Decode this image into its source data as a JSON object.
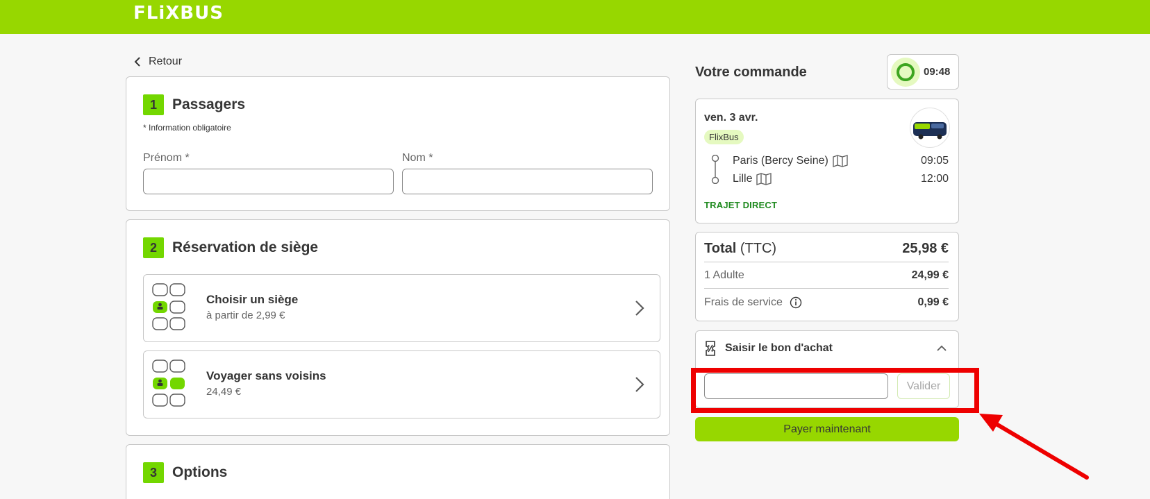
{
  "header": {
    "logo": "FLiXBUS"
  },
  "nav": {
    "back_label": "Retour"
  },
  "passengers": {
    "step": "1",
    "title": "Passagers",
    "required_note": "* Information obligatoire",
    "first_name_label": "Prénom *",
    "last_name_label": "Nom *"
  },
  "seats": {
    "step": "2",
    "title": "Réservation de siège",
    "options": [
      {
        "title": "Choisir un siège",
        "subtitle": "à partir de 2,99 €"
      },
      {
        "title": "Voyager sans voisins",
        "subtitle": "24,49 €"
      }
    ]
  },
  "options": {
    "step": "3",
    "title": "Options"
  },
  "order": {
    "title": "Votre commande",
    "timer": "09:48",
    "trip": {
      "date": "ven. 3 avr.",
      "brand": "FlixBus",
      "stops": [
        {
          "city": "Paris (Bercy Seine)",
          "time": "09:05"
        },
        {
          "city": "Lille",
          "time": "12:00"
        }
      ],
      "direct_label": "TRAJET DIRECT"
    },
    "totals": {
      "total_label": "Total",
      "total_suffix": "(TTC)",
      "total_value": "25,98 €",
      "lines": [
        {
          "label": "1 Adulte",
          "value": "24,99 €"
        },
        {
          "label": "Frais de service",
          "value": "0,99 €"
        }
      ]
    },
    "voucher": {
      "title": "Saisir le bon d'achat",
      "input_value": "",
      "button_label": "Valider"
    },
    "pay_label": "Payer maintenant"
  },
  "colors": {
    "brand_green": "#97d700",
    "step_green": "#73d700",
    "annotation_red": "#ee0000"
  }
}
